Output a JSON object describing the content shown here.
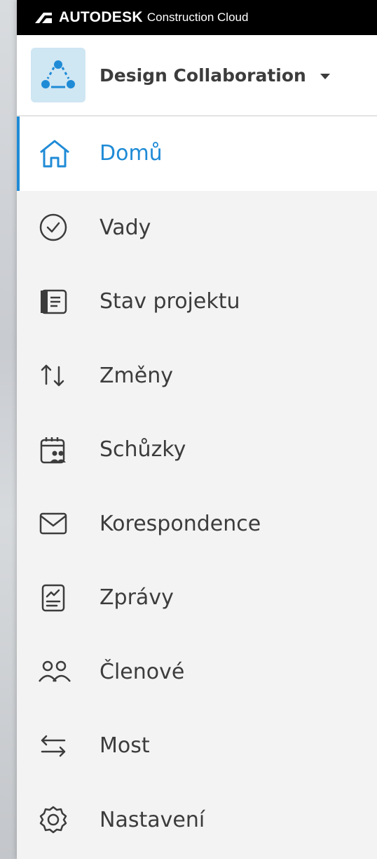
{
  "brand": {
    "name": "AUTODESK",
    "product": "Construction Cloud"
  },
  "module": {
    "title": "Design Collaboration",
    "icon": "design-collaboration-icon"
  },
  "nav": {
    "items": [
      {
        "label": "Domů",
        "icon": "home-icon",
        "active": true
      },
      {
        "label": "Vady",
        "icon": "check-circle-icon"
      },
      {
        "label": "Stav projektu",
        "icon": "document-list-icon"
      },
      {
        "label": "Změny",
        "icon": "arrows-up-down-icon"
      },
      {
        "label": "Schůzky",
        "icon": "calendar-people-icon"
      },
      {
        "label": "Korespondence",
        "icon": "envelope-icon"
      },
      {
        "label": "Zprávy",
        "icon": "report-icon"
      },
      {
        "label": "Členové",
        "icon": "people-icon"
      },
      {
        "label": "Most",
        "icon": "arrows-left-right-icon"
      },
      {
        "label": "Nastavení",
        "icon": "gear-icon"
      }
    ]
  },
  "colors": {
    "accent": "#1f8bd6",
    "text": "#3c3c3c",
    "panel": "#f3f3f3",
    "brand_bar": "#000000",
    "module_badge": "#cfe6f3"
  }
}
